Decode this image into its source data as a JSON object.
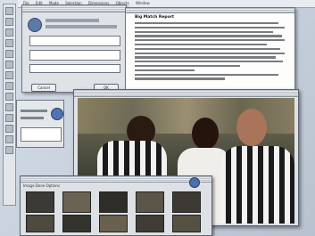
{
  "menubar": {
    "items": [
      "File",
      "Edit",
      "Mode",
      "Selection",
      "Dimensions",
      "Objects",
      "Window"
    ]
  },
  "document": {
    "title": "Big Match Report"
  },
  "dialog": {
    "buttons": [
      "Cancel",
      "OK"
    ]
  },
  "strip": {
    "toolbar_text": "Image  Done  Options"
  },
  "colors": {
    "desktop": "#c9d3de",
    "accent": "#4f73b5"
  }
}
